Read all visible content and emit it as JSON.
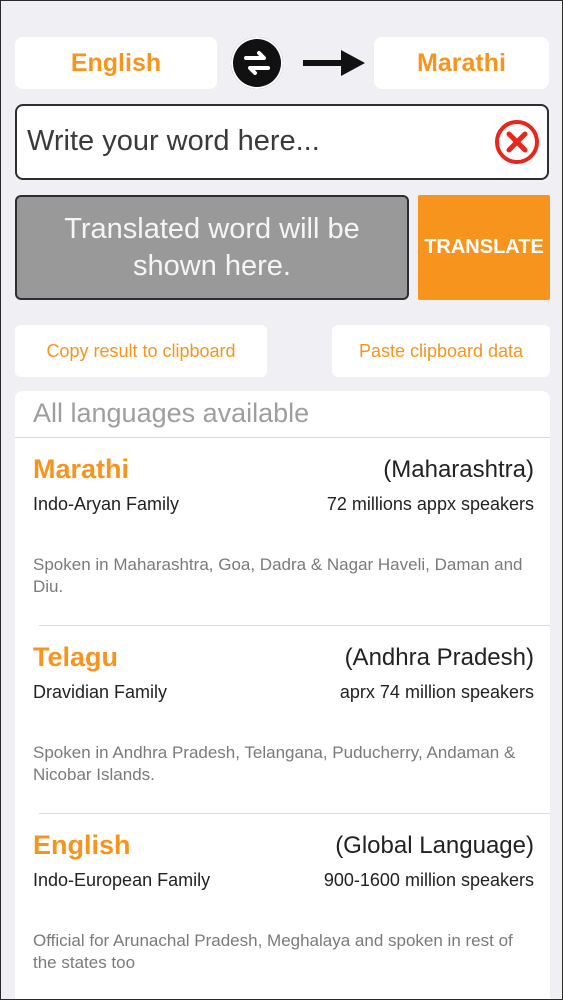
{
  "header": {
    "source_language": "English",
    "target_language": "Marathi"
  },
  "input": {
    "placeholder": "Write your word here...",
    "value": ""
  },
  "result": {
    "placeholder_text": "Translated word will be shown here."
  },
  "actions": {
    "translate_label": "TRANSLATE",
    "copy_label": "Copy result to clipboard",
    "paste_label": "Paste clipboard data"
  },
  "list": {
    "header": "All languages available",
    "items": [
      {
        "name": "Marathi",
        "region": "(Maharashtra)",
        "family": "Indo-Aryan Family",
        "speakers": "72 millions appx speakers",
        "description": "Spoken in Maharashtra, Goa, Dadra & Nagar Haveli, Daman and Diu."
      },
      {
        "name": "Telagu",
        "region": "(Andhra Pradesh)",
        "family": "Dravidian Family",
        "speakers": "aprx 74 million speakers",
        "description": "Spoken in Andhra Pradesh, Telangana, Puducherry, Andaman & Nicobar Islands."
      },
      {
        "name": "English",
        "region": "(Global Language)",
        "family": "Indo-European Family",
        "speakers": "900-1600 million speakers",
        "description": "Official for Arunachal Pradesh, Meghalaya and spoken in rest of the states too"
      }
    ]
  },
  "icons": {
    "swap": "swap-icon",
    "arrow": "arrow-right-icon",
    "clear": "clear-circle-x-icon"
  },
  "colors": {
    "accent": "#f7941d",
    "background": "#efeff4",
    "result_box": "#999999"
  }
}
